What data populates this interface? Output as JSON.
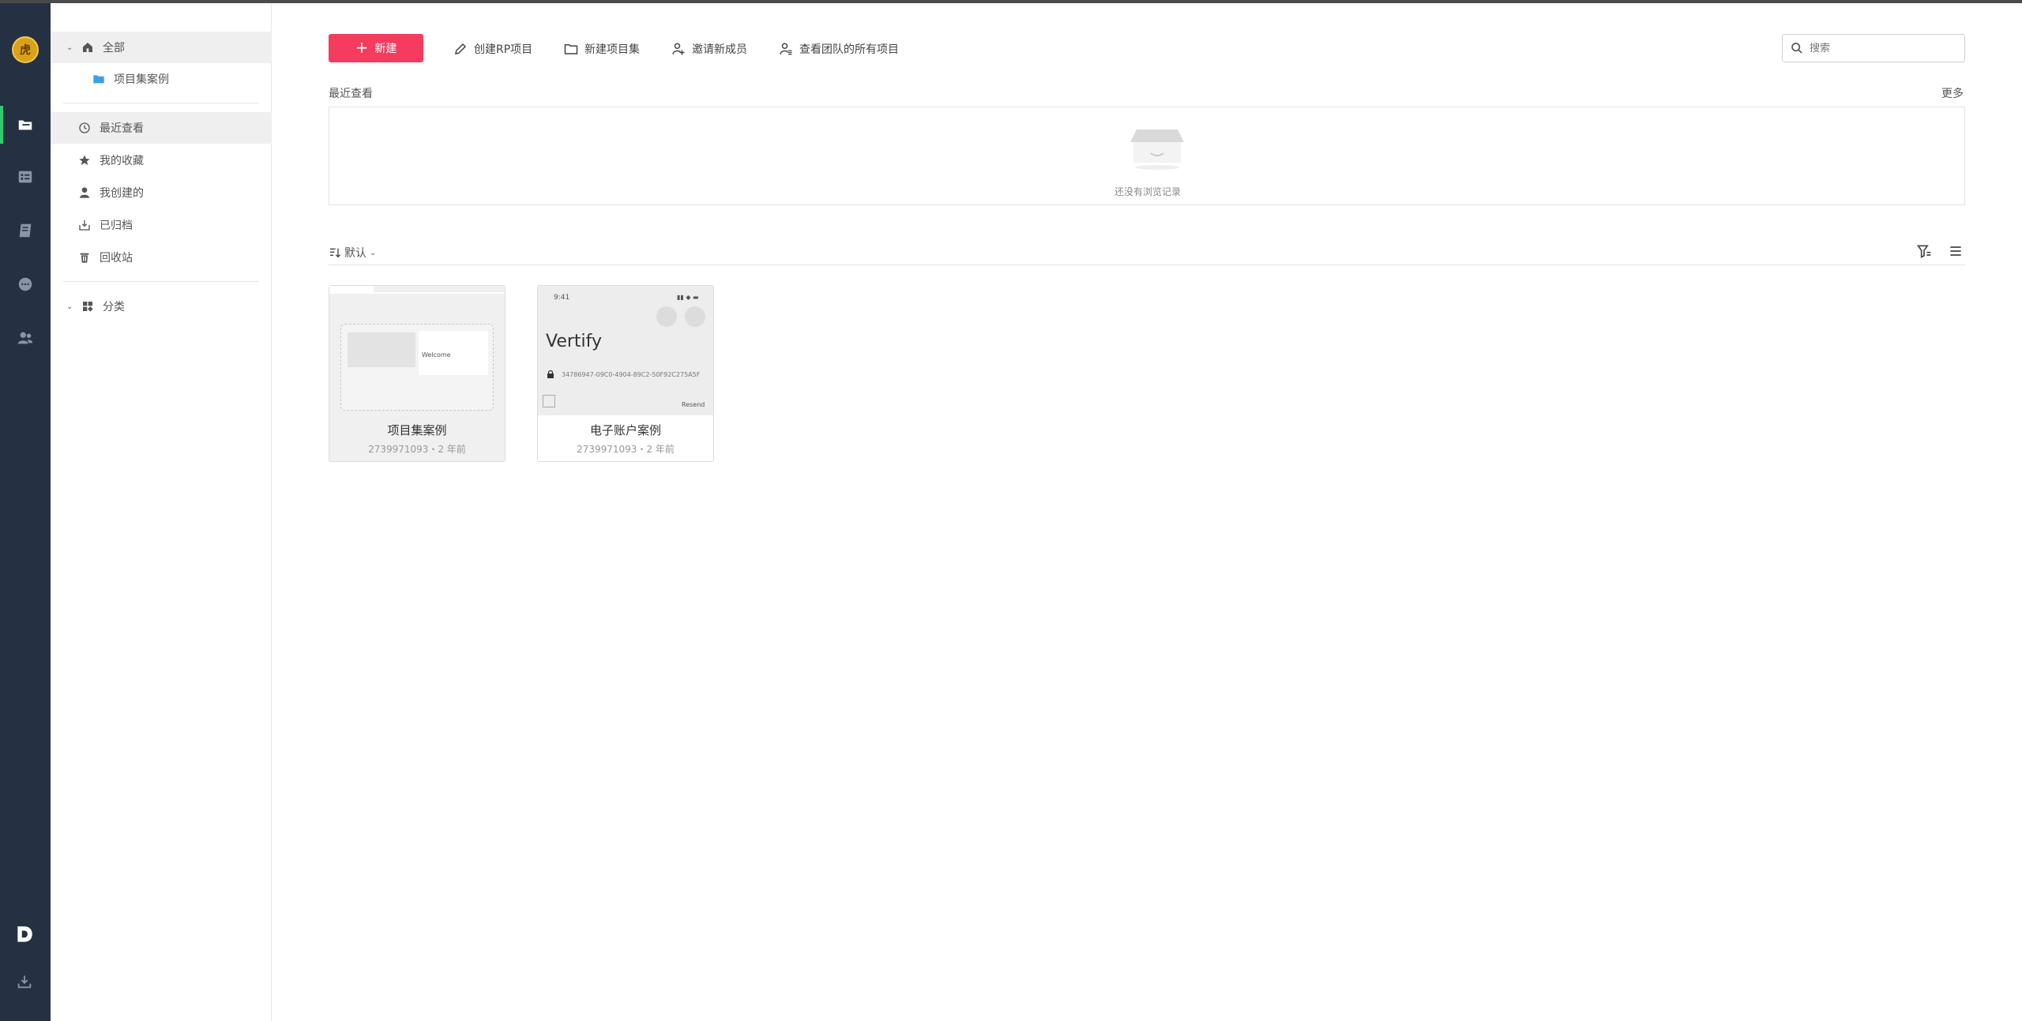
{
  "rail": {
    "avatar_text": "虎",
    "items": [
      "files-icon",
      "checklist-icon",
      "book-icon",
      "chat-icon",
      "team-icon"
    ],
    "accent": "#2ecc71"
  },
  "sidebar": {
    "all": "全部",
    "project_set_example": "项目集案例",
    "recent": "最近查看",
    "favorites": "我的收藏",
    "created": "我创建的",
    "archived": "已归档",
    "trash": "回收站",
    "category": "分类"
  },
  "toolbar": {
    "new_label": "新建",
    "create_rp": "创建RP项目",
    "new_project_set": "新建项目集",
    "invite": "邀请新成员",
    "view_all": "查看团队的所有项目",
    "search_placeholder": "搜索"
  },
  "recent": {
    "title": "最近查看",
    "more": "更多",
    "empty": "还没有浏览记录"
  },
  "list": {
    "sort_label": "默认"
  },
  "cards": [
    {
      "title": "项目集案例",
      "meta": "2739971093・2 年前",
      "preview_welcome": "Welcome"
    },
    {
      "title": "电子账户案例",
      "meta": "2739971093・2 年前",
      "preview_time": "9:41",
      "preview_title": "Vertify",
      "preview_code": "34786947-09C0-4904-89C2-50F92C275A5F",
      "preview_resend": "Resend"
    }
  ],
  "colors": {
    "primary": "#f53b5e",
    "rail_bg": "#263043"
  }
}
